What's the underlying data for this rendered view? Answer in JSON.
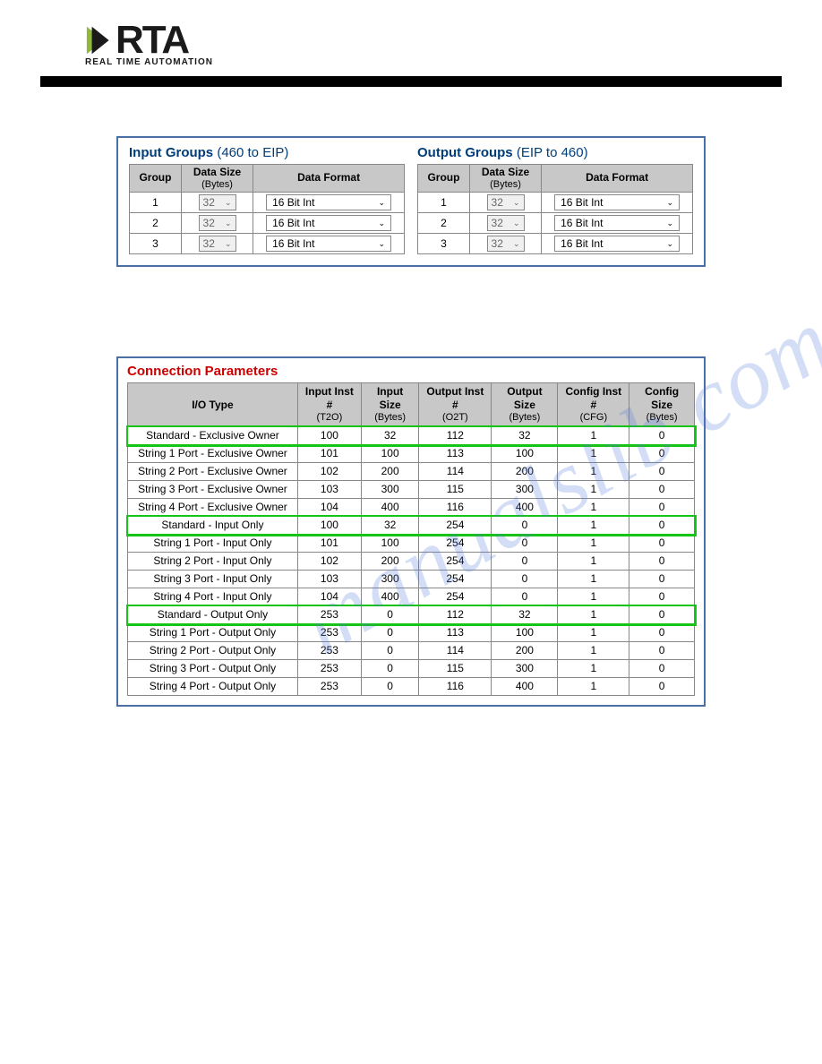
{
  "logo": {
    "name": "RTA",
    "tagline": "REAL TIME AUTOMATION"
  },
  "watermark": "manualslib.com",
  "input_groups": {
    "title": "Input Groups",
    "subtitle": "(460 to EIP)",
    "headers": {
      "group": "Group",
      "size": "Data Size",
      "size_sub": "(Bytes)",
      "format": "Data Format"
    },
    "rows": [
      {
        "group": "1",
        "size": "32",
        "format": "16 Bit Int"
      },
      {
        "group": "2",
        "size": "32",
        "format": "16 Bit Int"
      },
      {
        "group": "3",
        "size": "32",
        "format": "16 Bit Int"
      }
    ]
  },
  "output_groups": {
    "title": "Output Groups",
    "subtitle": "(EIP to 460)",
    "headers": {
      "group": "Group",
      "size": "Data Size",
      "size_sub": "(Bytes)",
      "format": "Data Format"
    },
    "rows": [
      {
        "group": "1",
        "size": "32",
        "format": "16 Bit Int"
      },
      {
        "group": "2",
        "size": "32",
        "format": "16 Bit Int"
      },
      {
        "group": "3",
        "size": "32",
        "format": "16 Bit Int"
      }
    ]
  },
  "connection": {
    "title": "Connection Parameters",
    "headers": {
      "io_type": "I/O Type",
      "in_inst": "Input Inst #",
      "in_inst_sub": "(T2O)",
      "in_size": "Input Size",
      "in_size_sub": "(Bytes)",
      "out_inst": "Output Inst #",
      "out_inst_sub": "(O2T)",
      "out_size": "Output Size",
      "out_size_sub": "(Bytes)",
      "cfg_inst": "Config Inst #",
      "cfg_inst_sub": "(CFG)",
      "cfg_size": "Config Size",
      "cfg_size_sub": "(Bytes)"
    },
    "rows": [
      {
        "hl": true,
        "io": "Standard - Exclusive Owner",
        "ii": "100",
        "is": "32",
        "oi": "112",
        "os": "32",
        "ci": "1",
        "cs": "0"
      },
      {
        "hl": false,
        "io": "String 1 Port - Exclusive Owner",
        "ii": "101",
        "is": "100",
        "oi": "113",
        "os": "100",
        "ci": "1",
        "cs": "0"
      },
      {
        "hl": false,
        "io": "String 2 Port - Exclusive Owner",
        "ii": "102",
        "is": "200",
        "oi": "114",
        "os": "200",
        "ci": "1",
        "cs": "0"
      },
      {
        "hl": false,
        "io": "String 3 Port - Exclusive Owner",
        "ii": "103",
        "is": "300",
        "oi": "115",
        "os": "300",
        "ci": "1",
        "cs": "0"
      },
      {
        "hl": false,
        "io": "String 4 Port - Exclusive Owner",
        "ii": "104",
        "is": "400",
        "oi": "116",
        "os": "400",
        "ci": "1",
        "cs": "0"
      },
      {
        "hl": true,
        "io": "Standard - Input Only",
        "ii": "100",
        "is": "32",
        "oi": "254",
        "os": "0",
        "ci": "1",
        "cs": "0"
      },
      {
        "hl": false,
        "io": "String 1 Port - Input Only",
        "ii": "101",
        "is": "100",
        "oi": "254",
        "os": "0",
        "ci": "1",
        "cs": "0"
      },
      {
        "hl": false,
        "io": "String 2 Port - Input Only",
        "ii": "102",
        "is": "200",
        "oi": "254",
        "os": "0",
        "ci": "1",
        "cs": "0"
      },
      {
        "hl": false,
        "io": "String 3 Port - Input Only",
        "ii": "103",
        "is": "300",
        "oi": "254",
        "os": "0",
        "ci": "1",
        "cs": "0"
      },
      {
        "hl": false,
        "io": "String 4 Port - Input Only",
        "ii": "104",
        "is": "400",
        "oi": "254",
        "os": "0",
        "ci": "1",
        "cs": "0"
      },
      {
        "hl": true,
        "io": "Standard - Output Only",
        "ii": "253",
        "is": "0",
        "oi": "112",
        "os": "32",
        "ci": "1",
        "cs": "0"
      },
      {
        "hl": false,
        "io": "String 1 Port - Output Only",
        "ii": "253",
        "is": "0",
        "oi": "113",
        "os": "100",
        "ci": "1",
        "cs": "0"
      },
      {
        "hl": false,
        "io": "String 2 Port - Output Only",
        "ii": "253",
        "is": "0",
        "oi": "114",
        "os": "200",
        "ci": "1",
        "cs": "0"
      },
      {
        "hl": false,
        "io": "String 3 Port - Output Only",
        "ii": "253",
        "is": "0",
        "oi": "115",
        "os": "300",
        "ci": "1",
        "cs": "0"
      },
      {
        "hl": false,
        "io": "String 4 Port - Output Only",
        "ii": "253",
        "is": "0",
        "oi": "116",
        "os": "400",
        "ci": "1",
        "cs": "0"
      }
    ]
  }
}
